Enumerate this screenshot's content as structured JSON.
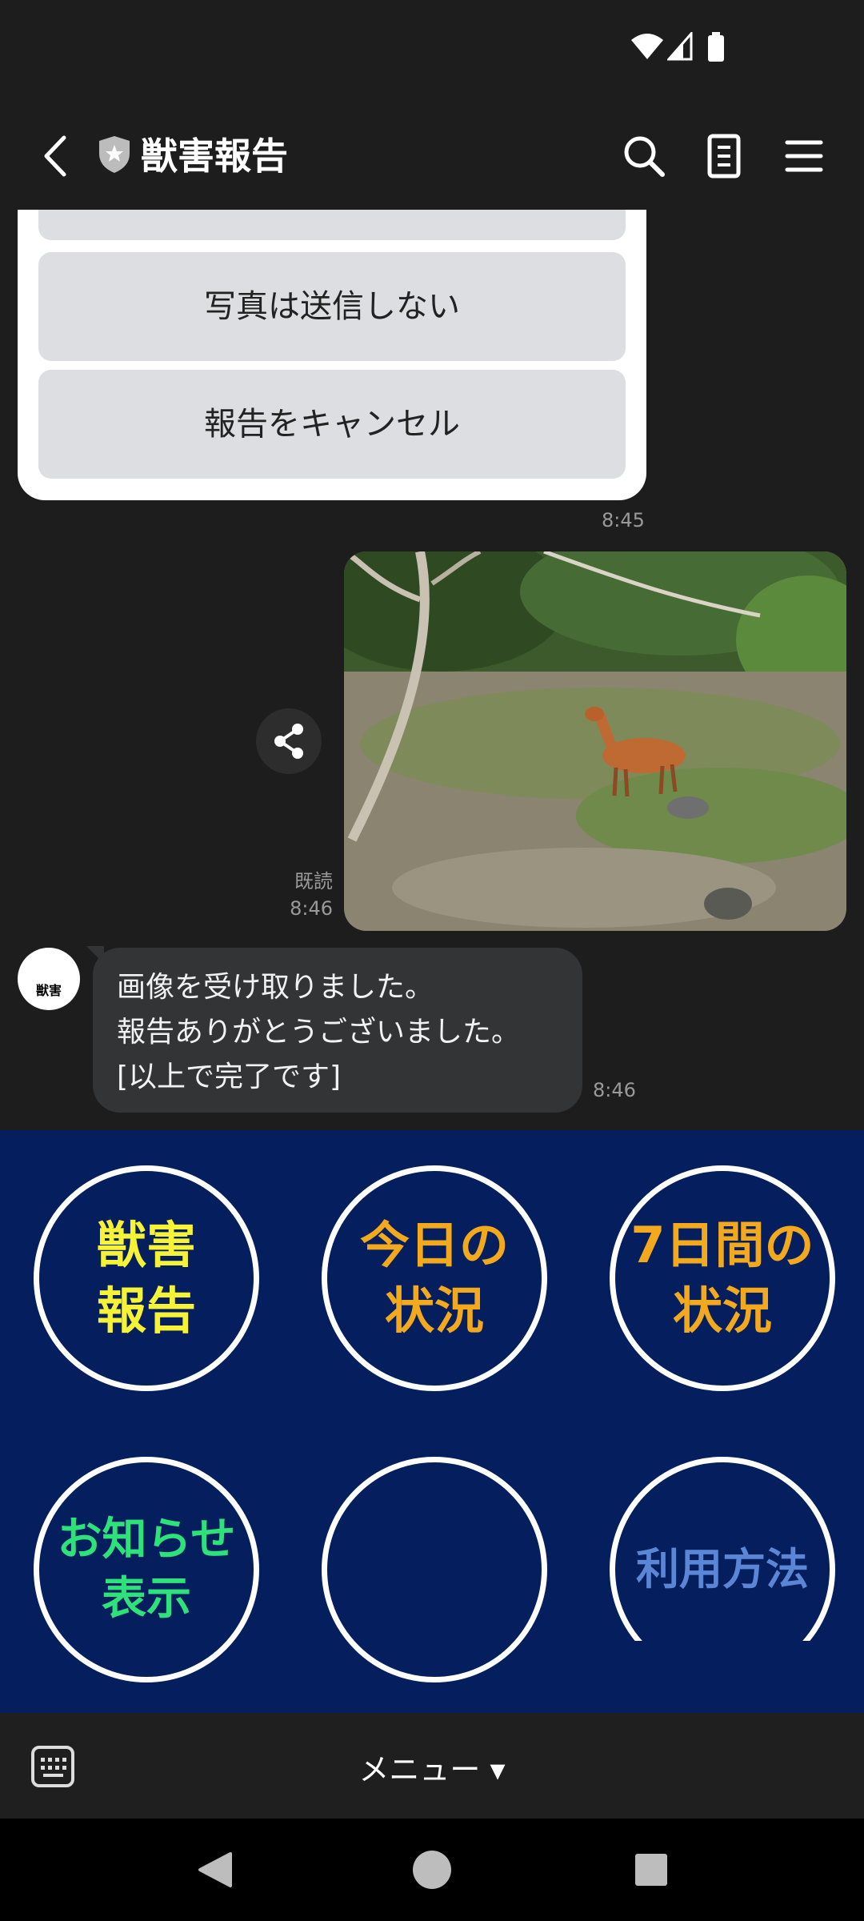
{
  "header": {
    "title": "獣害報告"
  },
  "chat": {
    "quick_replies": [
      {
        "label": "写真は送信しない"
      },
      {
        "label": "報告をキャンセル"
      }
    ],
    "card_time": "8:45",
    "photo_read": "既読",
    "photo_time": "8:46",
    "bot_avatar_text": "獣害",
    "bot_message": {
      "lines": [
        "画像を受け取りました。",
        "報告ありがとうございました。",
        "[以上で完了です]"
      ],
      "time": "8:46"
    }
  },
  "rich_menu": {
    "items": [
      {
        "label": "獣害\n報告",
        "color": "#f6f235"
      },
      {
        "label": "今日の\n状況",
        "color": "#f2a91e"
      },
      {
        "label": "7日間の\n状況",
        "color": "#f2a91e"
      },
      {
        "label": "お知らせ\n表示",
        "color": "#2ee27a"
      },
      {
        "label": "",
        "color": "#ffffff"
      },
      {
        "label": "利用方法",
        "color": "#5b86d6"
      }
    ]
  },
  "menubar": {
    "menu_label": "メニュー ▾"
  },
  "colors": {
    "rich_menu_bg": "#051e5e",
    "app_bg": "#1d1d1d",
    "bubble_bg": "#333436"
  }
}
